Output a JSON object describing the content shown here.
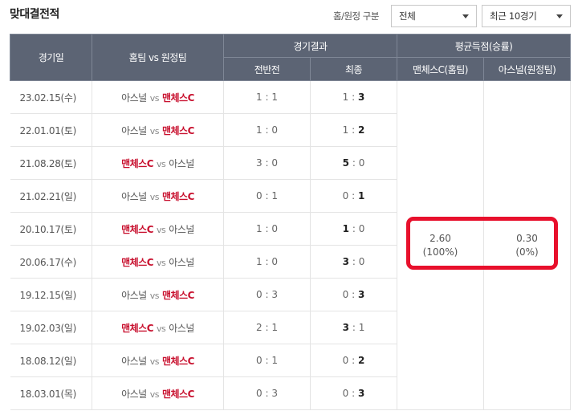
{
  "header": {
    "title": "맞대결전적",
    "filter_label": "홈/원정 구분",
    "home_select": "전체",
    "recent_select": "최근 10경기"
  },
  "columns": {
    "date": "경기일",
    "teams": "홈팀 vs 원정팀",
    "result": "경기결과",
    "half": "전반전",
    "final": "최종",
    "avg": "평균득점(승률)",
    "avg_home": "맨체스C(홈팀)",
    "avg_away": "아스널(원정팀)"
  },
  "vs": "vs",
  "averages": {
    "home_score": "2.60",
    "home_rate": "(100%)",
    "away_score": "0.30",
    "away_rate": "(0%)"
  },
  "matches": [
    {
      "date": "23.02.15(수)",
      "home": "아스널",
      "away": "맨체스C",
      "half": "1 : 1",
      "final_h": "1",
      "final_a": "3"
    },
    {
      "date": "22.01.01(토)",
      "home": "아스널",
      "away": "맨체스C",
      "half": "1 : 0",
      "final_h": "1",
      "final_a": "2"
    },
    {
      "date": "21.08.28(토)",
      "home": "맨체스C",
      "away": "아스널",
      "half": "3 : 0",
      "final_h": "5",
      "final_a": "0"
    },
    {
      "date": "21.02.21(일)",
      "home": "아스널",
      "away": "맨체스C",
      "half": "0 : 1",
      "final_h": "0",
      "final_a": "1"
    },
    {
      "date": "20.10.17(토)",
      "home": "맨체스C",
      "away": "아스널",
      "half": "1 : 0",
      "final_h": "1",
      "final_a": "0"
    },
    {
      "date": "20.06.17(수)",
      "home": "맨체스C",
      "away": "아스널",
      "half": "1 : 0",
      "final_h": "3",
      "final_a": "0"
    },
    {
      "date": "19.12.15(일)",
      "home": "아스널",
      "away": "맨체스C",
      "half": "0 : 3",
      "final_h": "0",
      "final_a": "3"
    },
    {
      "date": "19.02.03(일)",
      "home": "맨체스C",
      "away": "아스널",
      "half": "2 : 1",
      "final_h": "3",
      "final_a": "1"
    },
    {
      "date": "18.08.12(일)",
      "home": "아스널",
      "away": "맨체스C",
      "half": "0 : 1",
      "final_h": "0",
      "final_a": "2"
    },
    {
      "date": "18.03.01(목)",
      "home": "아스널",
      "away": "맨체스C",
      "half": "0 : 3",
      "final_h": "0",
      "final_a": "3"
    }
  ]
}
